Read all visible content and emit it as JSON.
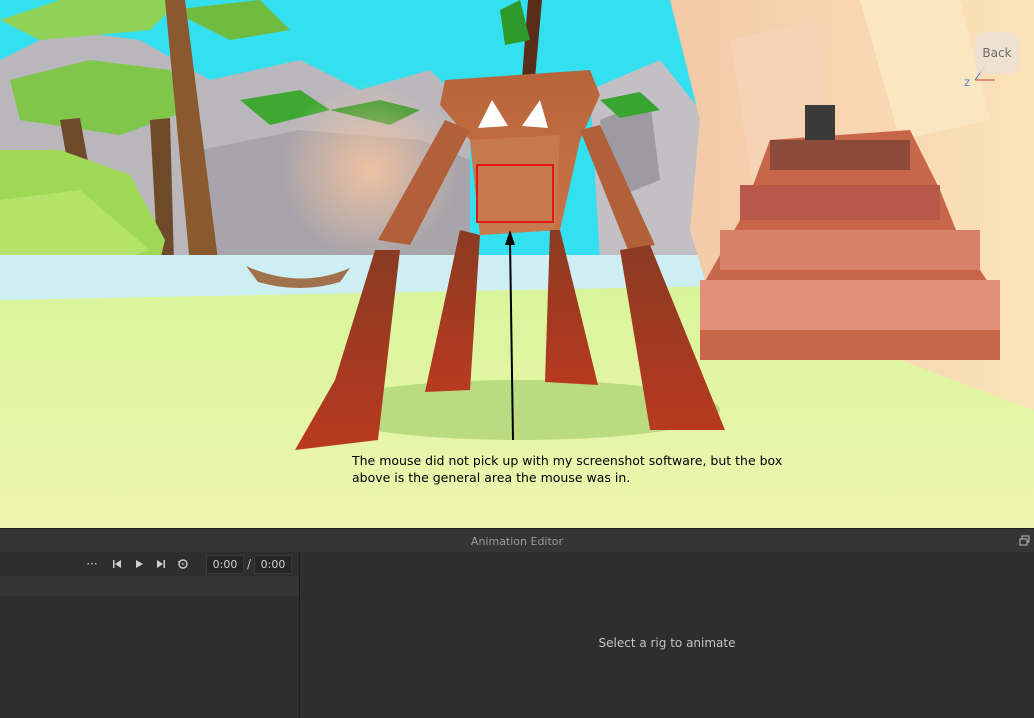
{
  "viewport": {
    "annotation_text": "The mouse did not pick up with my screenshot software, but the box above is the general area the mouse was in.",
    "back_button_label": "Back",
    "colors": {
      "sky": "#32e0ee",
      "grass": "#c8f08a",
      "creature": "#c0623a",
      "highlight_box": "#e01818"
    }
  },
  "animation_editor": {
    "title": "Animation Editor",
    "toolbar": {
      "more_label": "···",
      "current_time": "0:00",
      "separator": "/",
      "total_time": "0:00"
    },
    "empty_message": "Select a rig to animate"
  },
  "icons": [
    "more-icon",
    "skip-to-start-icon",
    "play-icon",
    "skip-to-end-icon",
    "loop-icon",
    "restore-window-icon",
    "axis-gizmo-icon"
  ]
}
